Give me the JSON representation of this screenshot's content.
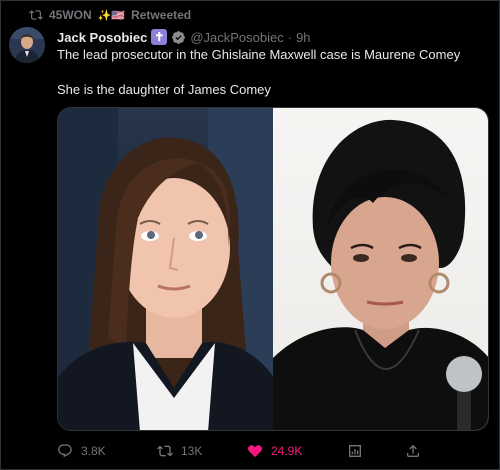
{
  "retweet": {
    "retweeter": "45WON",
    "badge": "✨🇺🇸",
    "label": "Retweeted"
  },
  "tweet": {
    "author_name": "Jack Posobiec",
    "author_badge": "✝",
    "handle": "@JackPosobiec",
    "separator": "·",
    "time": "9h",
    "text_line1": "The lead prosecutor in the Ghislaine Maxwell case is Maurene Comey",
    "text_line2": "She is the daughter of James Comey"
  },
  "actions": {
    "replies": "3.8K",
    "retweets": "13K",
    "likes": "24.9K"
  },
  "icons": [
    "retweet-icon",
    "verified-icon",
    "reply-icon",
    "heart-icon",
    "stats-icon",
    "share-icon"
  ],
  "colors": {
    "background": "#000000",
    "text": "#e7e9ea",
    "muted": "#71767b",
    "like": "#f91880",
    "verified": "#8e8e8e"
  }
}
